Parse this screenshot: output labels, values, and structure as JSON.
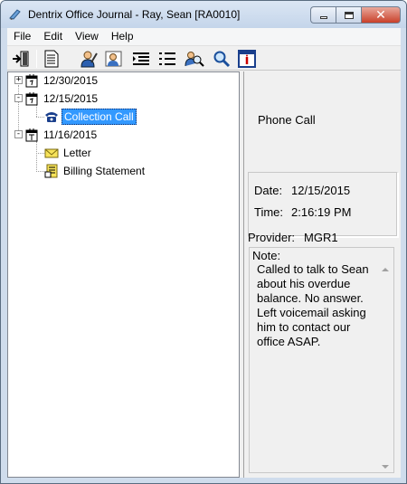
{
  "window": {
    "title": "Dentrix Office Journal - Ray, Sean  [RA0010]"
  },
  "menu": [
    "File",
    "Edit",
    "View",
    "Help"
  ],
  "toolbar": {
    "buttons": [
      "exit-icon",
      "document-icon",
      "person-edit-icon",
      "person-note-icon",
      "indent-list-icon",
      "outdent-list-icon",
      "find-person-icon",
      "search-icon",
      "info-icon"
    ]
  },
  "tree": {
    "nodes": [
      {
        "label": "12/30/2015",
        "expander": "+",
        "icon": "calendar-icon"
      },
      {
        "label": "12/15/2015",
        "expander": "-",
        "icon": "calendar-icon"
      },
      {
        "label": "Collection Call",
        "icon": "phone-icon",
        "selected": true
      },
      {
        "label": "11/16/2015",
        "expander": "-",
        "icon": "calendar-icon"
      },
      {
        "label": "Letter",
        "icon": "envelope-icon"
      },
      {
        "label": "Billing Statement",
        "icon": "statement-icon"
      }
    ]
  },
  "detail": {
    "type": "Phone Call",
    "date_label": "Date:",
    "date_value": "12/15/2015",
    "time_label": "Time:",
    "time_value": "2:16:19 PM",
    "provider_label": "Provider:",
    "provider_value": "MGR1",
    "note_label": "Note:",
    "note_text": "Called to talk to Sean about his overdue balance. No answer. Left voicemail asking him to contact our office ASAP."
  }
}
